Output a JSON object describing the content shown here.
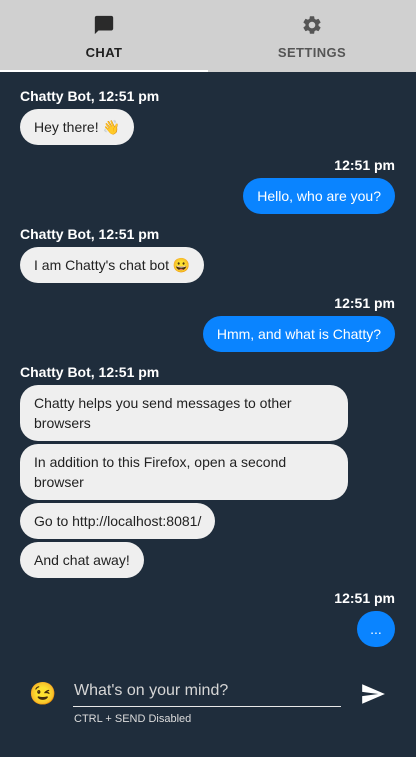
{
  "tabs": [
    {
      "label": "CHAT",
      "icon": "chat-bubble-icon",
      "active": true
    },
    {
      "label": "SETTINGS",
      "icon": "gear-icon",
      "active": false
    }
  ],
  "messages": [
    {
      "meta": "Chatty Bot, 12:51 pm",
      "bubbles": [
        "Hey there! 👋"
      ]
    },
    {
      "meta": "12:51 pm",
      "bubbles": [
        "Hello, who are you?"
      ]
    },
    {
      "meta": "Chatty Bot, 12:51 pm",
      "bubbles": [
        "I am Chatty's chat bot 😀"
      ]
    },
    {
      "meta": "12:51 pm",
      "bubbles": [
        "Hmm, and what is Chatty?"
      ]
    },
    {
      "meta": "Chatty Bot, 12:51 pm",
      "bubbles": [
        "Chatty helps you send messages to other browsers",
        "In addition to this Firefox, open a second browser",
        "Go to http://localhost:8081/",
        "And chat away!"
      ]
    },
    {
      "meta": "12:51 pm",
      "bubbles": [
        "..."
      ]
    }
  ],
  "composer": {
    "emoji": "😉",
    "placeholder": "What's on your mind?",
    "hint": "CTRL + SEND Disabled",
    "send_icon": "send-icon"
  },
  "colors": {
    "background": "#1f2d3c",
    "tab_bar": "#d0d0d0",
    "bot_bubble": "#efefef",
    "user_bubble": "#0a84ff"
  }
}
